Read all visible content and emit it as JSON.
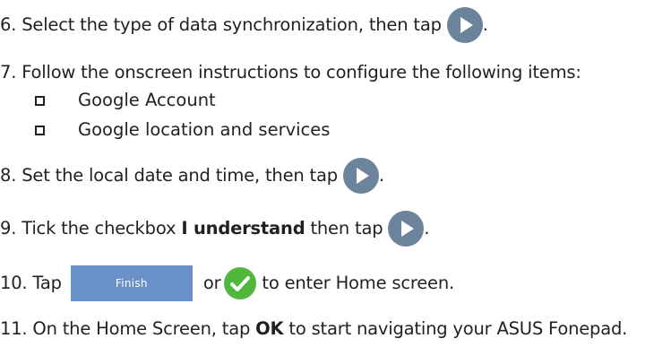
{
  "steps": [
    {
      "num": "6.",
      "text": "Select the type of data synchronization, then tap",
      "end": "."
    },
    {
      "num": "7.",
      "text": "Follow the onscreen instructions to configure the following items:"
    },
    {
      "num": "8.",
      "text": "Set the local date and time, then tap",
      "end": "."
    },
    {
      "num": "9.",
      "text_before": "Tick the checkbox",
      "bold": "I understand",
      "text_after": "then tap",
      "end": "."
    },
    {
      "num": "10.",
      "text_before": "Tap",
      "finish_label": "Finish",
      "or_label": "or",
      "text_after": "to enter Home screen."
    },
    {
      "num": "11.",
      "text_before": "On the Home Screen, tap",
      "bold": "OK",
      "text_after": "to start navigating your ASUS Fonepad."
    }
  ],
  "checklist": [
    "Google Account",
    "Google location and services"
  ],
  "colors": {
    "play_button": "#6b839b",
    "check_button": "#4fb83c",
    "finish_button": "#6b92c8"
  },
  "icons": {
    "play": "play-icon",
    "check": "checkmark-icon"
  }
}
